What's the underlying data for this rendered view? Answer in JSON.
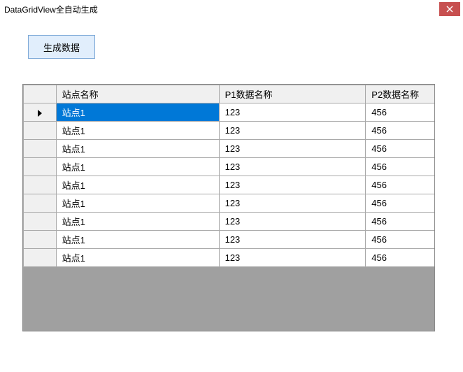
{
  "window": {
    "title": "DataGridView全自动生成"
  },
  "toolbar": {
    "generate_label": "生成数据"
  },
  "grid": {
    "columns": [
      "站点名称",
      "P1数据名称",
      "P2数据名称"
    ],
    "selected_row": 0,
    "rows": [
      {
        "name": "站点1",
        "p1": "123",
        "p2": "456"
      },
      {
        "name": "站点1",
        "p1": "123",
        "p2": "456"
      },
      {
        "name": "站点1",
        "p1": "123",
        "p2": "456"
      },
      {
        "name": "站点1",
        "p1": "123",
        "p2": "456"
      },
      {
        "name": "站点1",
        "p1": "123",
        "p2": "456"
      },
      {
        "name": "站点1",
        "p1": "123",
        "p2": "456"
      },
      {
        "name": "站点1",
        "p1": "123",
        "p2": "456"
      },
      {
        "name": "站点1",
        "p1": "123",
        "p2": "456"
      },
      {
        "name": "站点1",
        "p1": "123",
        "p2": "456"
      }
    ]
  }
}
